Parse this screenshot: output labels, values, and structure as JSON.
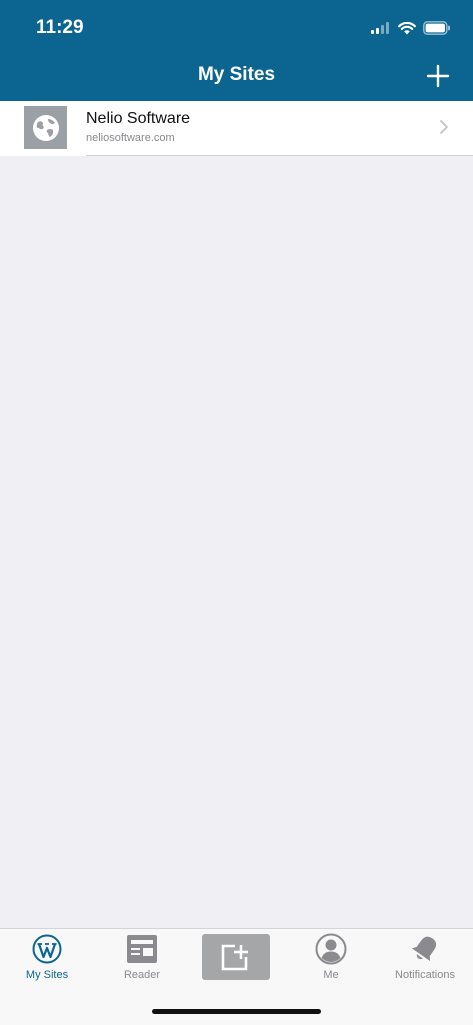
{
  "status": {
    "time": "11:29"
  },
  "nav": {
    "title": "My Sites"
  },
  "sites": [
    {
      "name": "Nelio Software",
      "url": "neliosoftware.com"
    }
  ],
  "tabs": {
    "my_sites": "My Sites",
    "reader": "Reader",
    "me": "Me",
    "notifications": "Notifications"
  },
  "colors": {
    "brand": "#0b6590",
    "background": "#efeff4",
    "inactive": "#8a8a8f"
  },
  "icons": [
    "signal-icon",
    "wifi-icon",
    "battery-icon",
    "plus-icon",
    "globe-icon",
    "chevron-right-icon",
    "wordpress-icon",
    "reader-icon",
    "write-post-icon",
    "me-icon",
    "notifications-bell-icon"
  ]
}
